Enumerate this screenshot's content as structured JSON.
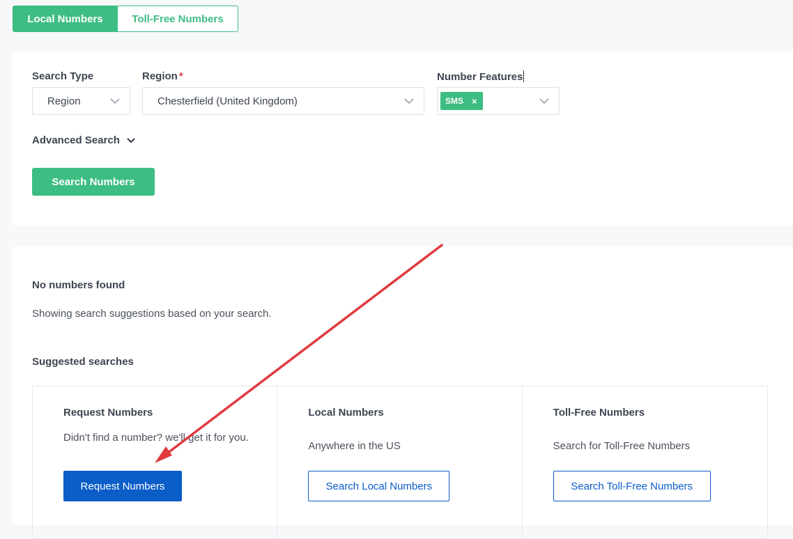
{
  "tabs": {
    "local": "Local Numbers",
    "tollfree": "Toll-Free Numbers"
  },
  "search_form": {
    "search_type_label": "Search Type",
    "search_type_value": "Region",
    "region_label": "Region",
    "region_required_mark": "*",
    "region_value": "Chesterfield (United Kingdom)",
    "features_label": "Number Features",
    "features_tag": "SMS",
    "features_tag_remove": "×",
    "advanced_label": "Advanced Search",
    "search_button": "Search Numbers"
  },
  "results": {
    "empty_title": "No numbers found",
    "empty_subtitle": "Showing search suggestions based on your search.",
    "suggested_heading": "Suggested searches",
    "suggestions": [
      {
        "title": "Request Numbers",
        "description": "Didn't find a number? we'll get it for you.",
        "button": "Request Numbers"
      },
      {
        "title": "Local Numbers",
        "description": "Anywhere in the US",
        "button": "Search Local Numbers"
      },
      {
        "title": "Toll-Free Numbers",
        "description": "Search for Toll-Free Numbers",
        "button": "Search Toll-Free Numbers"
      }
    ]
  },
  "colors": {
    "brand_green": "#3dbd82",
    "primary_blue": "#0b5dc7",
    "annotation_red": "#e0393e"
  }
}
